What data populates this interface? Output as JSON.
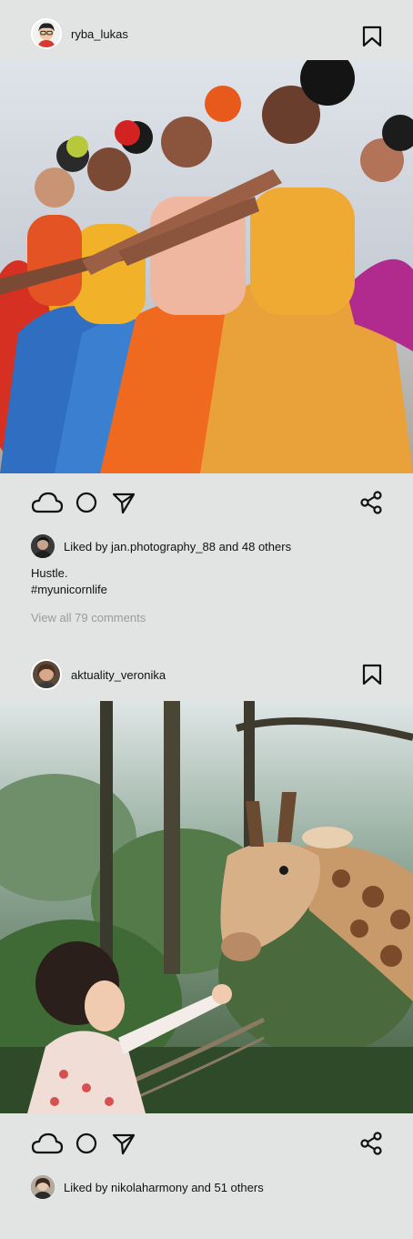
{
  "posts": [
    {
      "username": "ryba_lukas",
      "image_alt": "",
      "liked_by_text": "Liked by jan.photography_88 and 48 others",
      "caption_line1": "Hustle.",
      "caption_line2": "#myunicornlife",
      "view_comments": "View all 79 comments"
    },
    {
      "username": "aktuality_veronika",
      "image_alt": "",
      "liked_by_text": "Liked by nikolaharmony and 51 others"
    }
  ],
  "icons": {
    "like": "cloud-icon",
    "comment": "circle-icon",
    "send": "send-icon",
    "share": "share-icon",
    "bookmark": "bookmark-icon"
  }
}
